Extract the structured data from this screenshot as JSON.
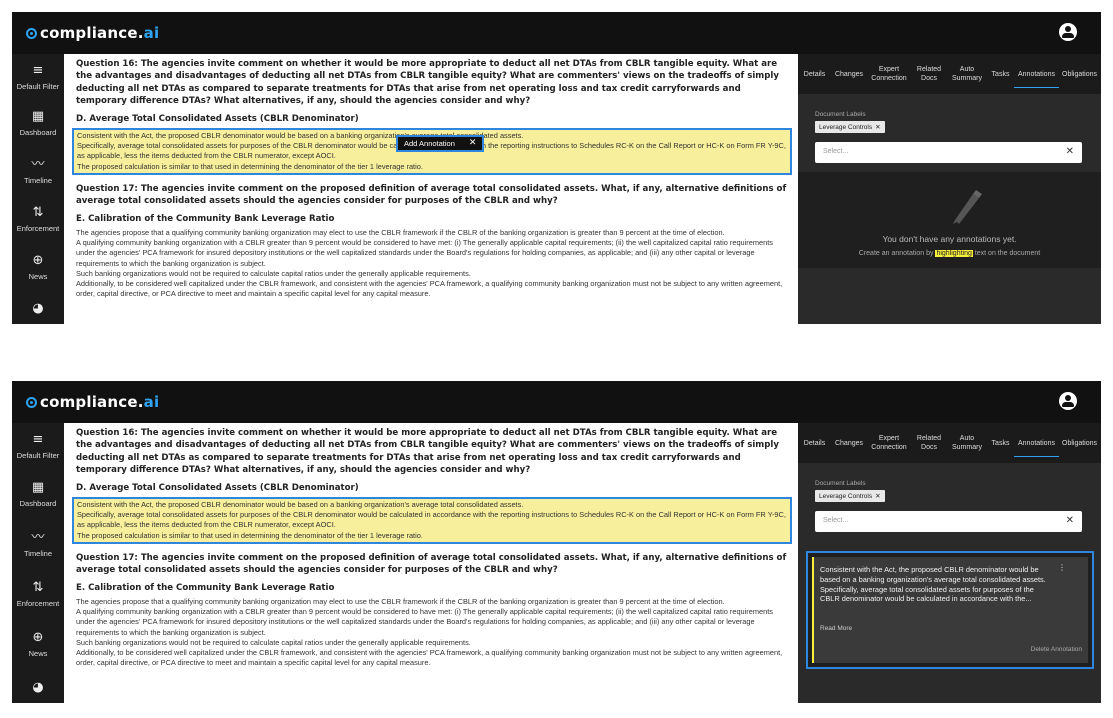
{
  "app": {
    "logo_brand": "compliance",
    "logo_dot": ".",
    "logo_ai": "ai"
  },
  "nav": {
    "items": [
      {
        "label": "Default Filter",
        "icon": "filter-icon"
      },
      {
        "label": "Dashboard",
        "icon": "dashboard-icon"
      },
      {
        "label": "Timeline",
        "icon": "timeline-icon"
      },
      {
        "label": "Enforcement",
        "icon": "enforcement-icon"
      },
      {
        "label": "News",
        "icon": "globe-icon"
      },
      {
        "label": "",
        "icon": "pie-icon"
      }
    ]
  },
  "doc": {
    "q16": "Question 16: The agencies invite comment on whether it would be more appropriate to deduct all net DTAs from CBLR tangible equity. What are the advantages and disadvantages of deducting all net DTAs from CBLR tangible equity? What are commenters' views on the tradeoffs of simply deducting all net DTAs as compared to separate treatments for DTAs that arise from net operating loss and tax credit carryforwards and temporary difference DTAs? What alternatives, if any, should the agencies consider and why?",
    "section_d": "D. Average Total Consolidated Assets (CBLR Denominator)",
    "highlight_lines": [
      "Consistent with the Act, the proposed CBLR denominator would be based on a banking organization's average total consolidated assets.",
      "Specifically, average total consolidated assets for purposes of the CBLR denominator would be calculated in accordance with the reporting instructions to Schedules RC-K on the Call Report or HC-K on Form FR Y-9C, as applicable, less the items deducted from the CBLR numerator, except AOCI.",
      "The proposed calculation is similar to that used in determining the denominator of the tier 1 leverage ratio."
    ],
    "q17": "Question 17: The agencies invite comment on the proposed definition of average total consolidated assets. What, if any, alternative definitions of average total consolidated assets should the agencies consider for purposes of the CBLR and why?",
    "section_e": "E. Calibration of the Community Bank Leverage Ratio",
    "e_lines": [
      "The agencies propose that a qualifying community banking organization may elect to use the CBLR framework if the CBLR of the banking organization is greater than 9 percent at the time of election.",
      "A qualifying community banking organization with a CBLR greater than 9 percent would be considered to have met: (i) The generally applicable capital requirements; (ii) the well capitalized capital ratio requirements under the agencies' PCA framework for insured depository institutions or the well capitalized standards under the Board's regulations for holding companies, as applicable; and (iii) any other capital or leverage requirements to which the banking organization is subject.",
      "Such banking organizations would not be required to calculate capital ratios under the generally applicable requirements.",
      "Additionally, to be considered well capitalized under the CBLR framework, and consistent with the agencies' PCA framework, a qualifying community banking organization must not be subject to any written agreement, order, capital directive, or PCA directive to meet and maintain a specific capital level for any capital measure."
    ]
  },
  "tooltip": {
    "label": "Add Annotation",
    "close": "✕"
  },
  "right": {
    "tabs": [
      {
        "label": "Details"
      },
      {
        "label": "Changes"
      },
      {
        "label": "Expert Connection"
      },
      {
        "label": "Related Docs"
      },
      {
        "label": "Auto Summary"
      },
      {
        "label": "Tasks"
      },
      {
        "label": "Annotations"
      },
      {
        "label": "Obligations"
      }
    ],
    "active_tab": "Annotations",
    "labels_title": "Document Labels",
    "chip": "Leverage Controls",
    "chip_x": "✕",
    "select_placeholder": "Select...",
    "select_x": "✕",
    "empty_title": "You don't have any annotations yet.",
    "empty_pre": "Create an annotation by ",
    "empty_hl": "highlighting",
    "empty_post": " text on the document"
  },
  "annotation": {
    "text": "Consistent with the Act, the proposed CBLR denominator would be based on a banking organization's average total consolidated assets. Specifically, average total consolidated assets for purposes of the CBLR denominator would be calculated in accordance with the...",
    "read_more": "Read More",
    "delete": "Delete Annotation",
    "kebab": "⋮"
  },
  "colors": {
    "accent": "#2ea3f2",
    "highlight": "#f7ef9b",
    "frame": "#2e86de"
  }
}
